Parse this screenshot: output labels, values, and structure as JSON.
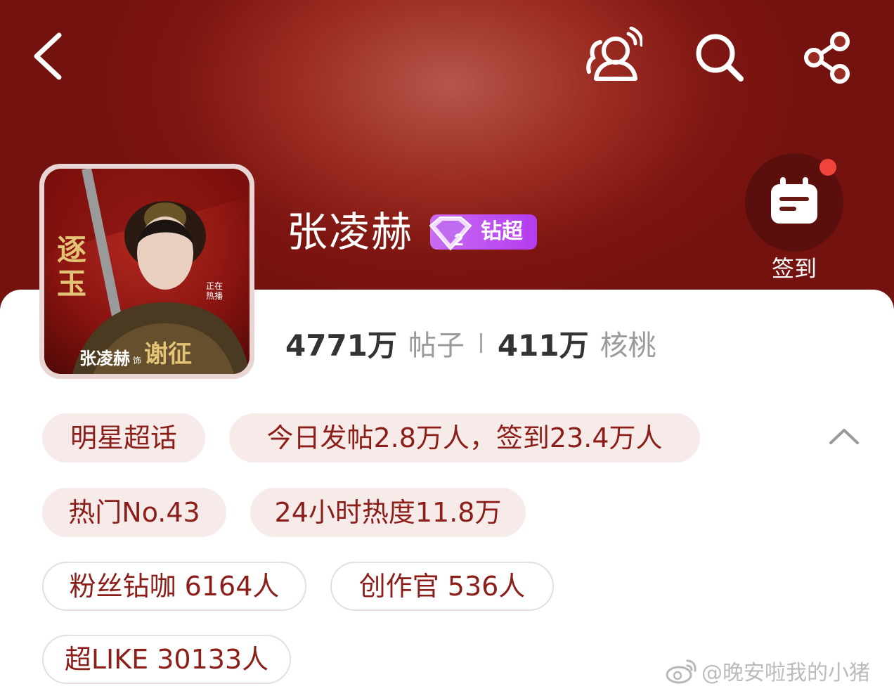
{
  "header": {
    "community_name": "张凌赫",
    "level_badge_text": "钻超",
    "level_number": "2",
    "checkin_label": "签到",
    "icons": [
      "back-icon",
      "community-chat-icon",
      "search-icon",
      "share-icon",
      "calendar-checkin-icon"
    ]
  },
  "avatar": {
    "poster_title": "逐玉",
    "poster_name": "张凌赫",
    "poster_role_prefix": "饰",
    "poster_role": "谢征",
    "poster_tag": "正在热播"
  },
  "stats": {
    "posts_count": "4771万",
    "posts_label": "帖子",
    "walnut_count": "411万",
    "walnut_label": "核桃"
  },
  "tags": {
    "category": "明星超话",
    "today_summary": "今日发帖2.8万人，签到23.4万人",
    "hot_rank": "热门No.43",
    "heat_24h": "24小时热度11.8万",
    "fan_diamond": "粉丝钻咖 6164人",
    "creator": "创作官 536人",
    "super_like": "超LIKE 30133人"
  },
  "watermark": "@晚安啦我的小猪",
  "colors": {
    "header_dark": "#7e1511",
    "header_light": "#b5564a",
    "chip_text": "#8c1e1a",
    "chip_fill": "#f6ebe9",
    "badge_purple": "#b43cf0",
    "notification_dot": "#f0443a"
  }
}
